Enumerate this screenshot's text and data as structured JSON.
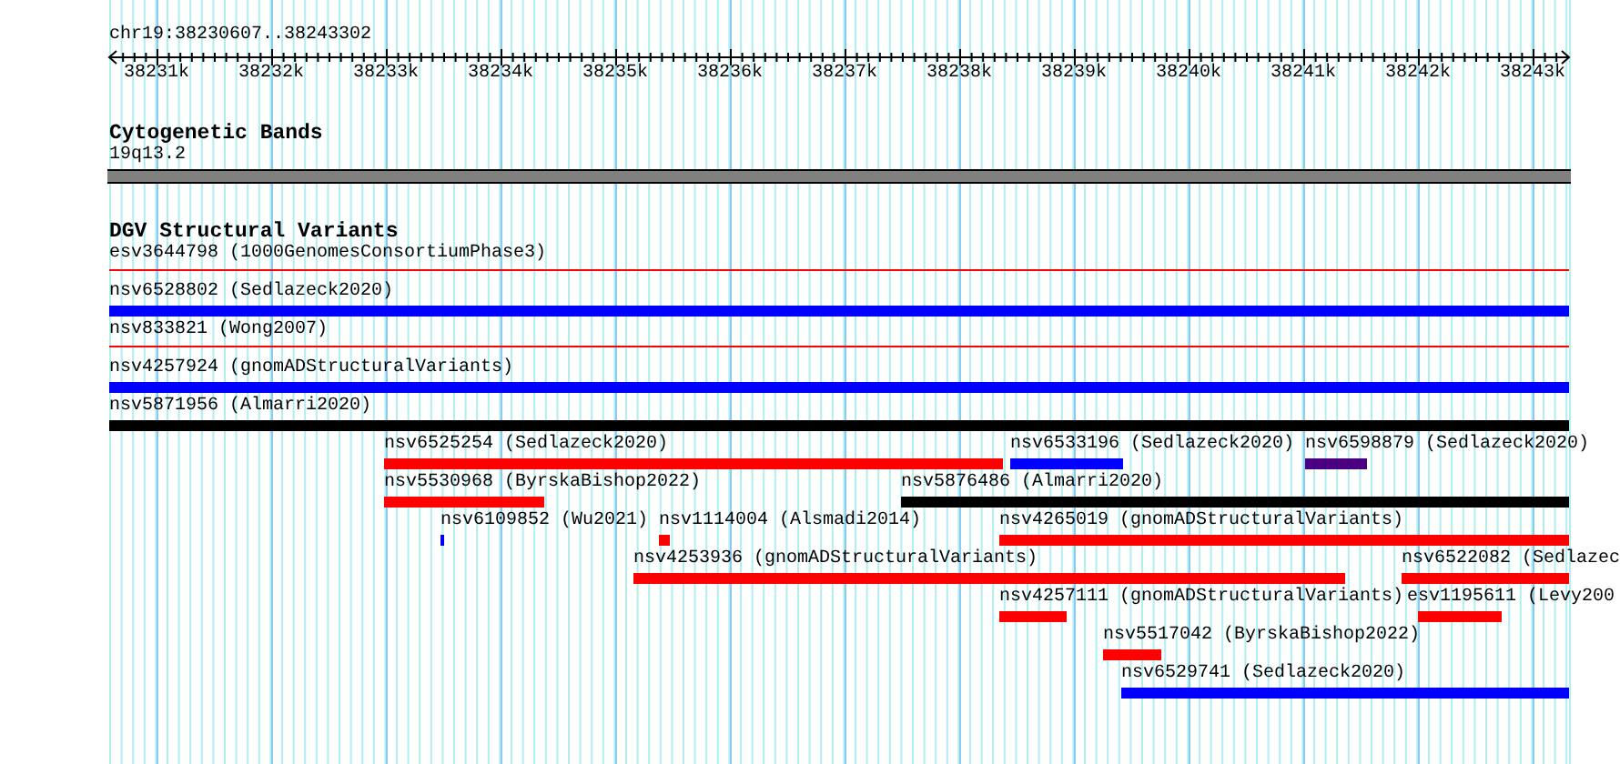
{
  "ruler": {
    "location": "chr19:38230607..38243302",
    "ticks": [
      "38231k",
      "38232k",
      "38233k",
      "38234k",
      "38235k",
      "38236k",
      "38237k",
      "38238k",
      "38239k",
      "38240k",
      "38241k",
      "38242k",
      "38243k"
    ]
  },
  "cytogenetic_bands": {
    "title": "Cytogenetic Bands",
    "band": "19q13.2"
  },
  "dgv_structural_variants": {
    "title": "DGV Structural Variants",
    "lanes": [
      [
        {
          "label": "esv3644798 (1000GenomesConsortiumPhase3)",
          "kind": "line",
          "color": "#ff0000"
        }
      ],
      [
        {
          "label": "nsv6528802 (Sedlazeck2020)",
          "kind": "bar",
          "color": "#0000ff"
        }
      ],
      [
        {
          "label": "nsv833821 (Wong2007)",
          "kind": "line",
          "color": "#ff0000"
        }
      ],
      [
        {
          "label": "nsv4257924 (gnomADStructuralVariants)",
          "kind": "bar",
          "color": "#0000ff"
        }
      ],
      [
        {
          "label": "nsv5871956 (Almarri2020)",
          "kind": "bar",
          "color": "#000000"
        }
      ],
      [
        {
          "label": "nsv6525254 (Sedlazeck2020)",
          "kind": "bar",
          "color": "#ff0000"
        },
        {
          "label": "nsv6533196 (Sedlazeck2020)",
          "kind": "bar",
          "color": "#0000ff"
        },
        {
          "label": "nsv6598879 (Sedlazeck2020)",
          "kind": "bar",
          "color": "#4b0082"
        }
      ],
      [
        {
          "label": "nsv5530968 (ByrskaBishop2022)",
          "kind": "bar",
          "color": "#ff0000"
        },
        {
          "label": "nsv5876486 (Almarri2020)",
          "kind": "bar",
          "color": "#000000"
        }
      ],
      [
        {
          "label": "nsv6109852 (Wu2021)",
          "kind": "bar",
          "color": "#0000ff"
        },
        {
          "label": "nsv1114004 (Alsmadi2014)",
          "kind": "bar",
          "color": "#ff0000"
        },
        {
          "label": "nsv4265019 (gnomADStructuralVariants)",
          "kind": "bar",
          "color": "#ff0000"
        }
      ],
      [
        {
          "label": "nsv4253936 (gnomADStructuralVariants)",
          "kind": "bar",
          "color": "#ff0000"
        },
        {
          "label": "nsv6522082 (Sedlazec",
          "kind": "bar",
          "color": "#ff0000"
        }
      ],
      [
        {
          "label": "nsv4257111 (gnomADStructuralVariants)",
          "kind": "bar",
          "color": "#ff0000"
        },
        {
          "label": "esv1195611 (Levy200",
          "kind": "bar",
          "color": "#ff0000"
        }
      ],
      [
        {
          "label": "nsv5517042 (ByrskaBishop2022)",
          "kind": "bar",
          "color": "#ff0000"
        }
      ],
      [
        {
          "label": "nsv6529741 (Sedlazeck2020)",
          "kind": "bar",
          "color": "#0000ff"
        }
      ]
    ]
  }
}
